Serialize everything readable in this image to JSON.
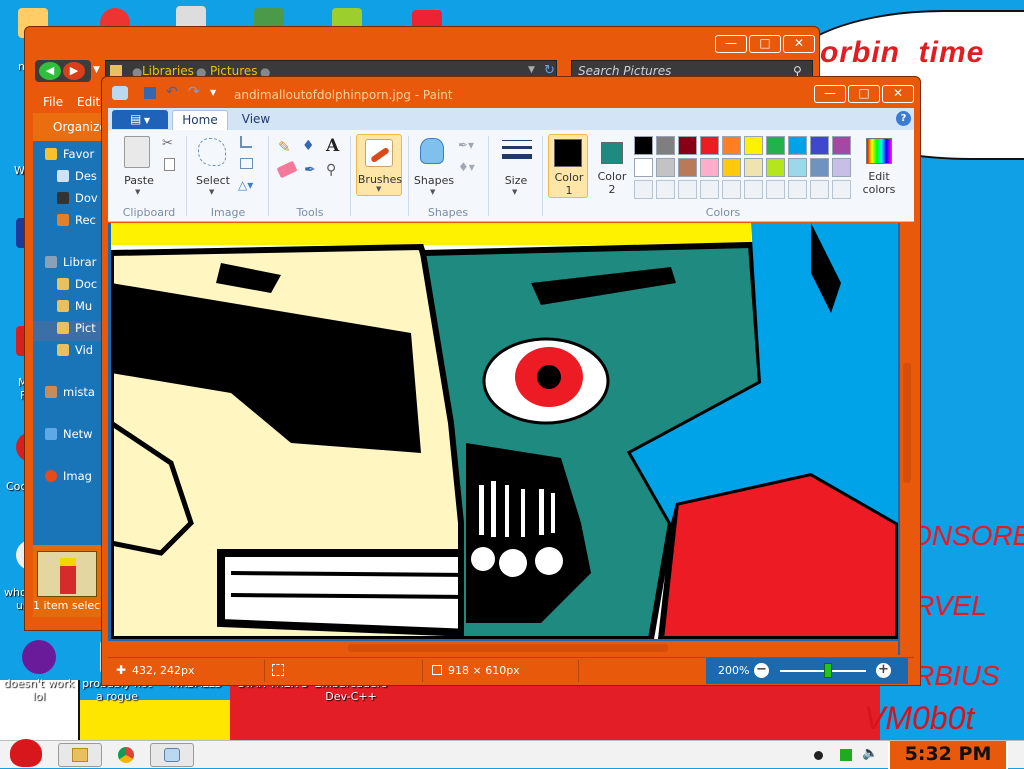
{
  "wallpaper": {
    "title": "orbin  time",
    "words": [
      "ONSORE",
      "RVEL",
      "RBIUS",
      "VM0b0t"
    ]
  },
  "desktop_icons": [
    {
      "label": "doesn't work lol"
    },
    {
      "label": "probably not a rogue"
    },
    {
      "label": "INKBALLS"
    },
    {
      "label": "STAR TREK 3"
    },
    {
      "label": "Embarcadero Dev-C++"
    }
  ],
  "desktop_edge_labels": [
    "m",
    "W",
    "M",
    "F",
    "Coc",
    "who",
    "us"
  ],
  "explorer": {
    "breadcrumb": [
      "Libraries",
      "Pictures"
    ],
    "search_placeholder": "Search Pictures",
    "menu": [
      "File",
      "Edit"
    ],
    "organize_label": "Organize",
    "nav": [
      {
        "label": "Favor",
        "icon": "star-icon"
      },
      {
        "label": "Des",
        "icon": "folder-icon"
      },
      {
        "label": "Dov",
        "icon": "folder-icon"
      },
      {
        "label": "Rec",
        "icon": "folder-icon"
      },
      {
        "label": "Librar",
        "icon": "library-icon"
      },
      {
        "label": "Doc",
        "icon": "folder-icon"
      },
      {
        "label": "Mu",
        "icon": "music-icon"
      },
      {
        "label": "Pict",
        "icon": "picture-icon"
      },
      {
        "label": "Vid",
        "icon": "video-icon"
      },
      {
        "label": "mista",
        "icon": "user-icon"
      },
      {
        "label": "Netw",
        "icon": "network-icon"
      },
      {
        "label": "Imag",
        "icon": "image-icon"
      }
    ],
    "status": "1 item select"
  },
  "paint": {
    "title": "andimalloutofdolphinporn.jpg - Paint",
    "tabs": {
      "file": "",
      "home": "Home",
      "view": "View"
    },
    "ribbon": {
      "paste": "Paste",
      "select": "Select",
      "brushes": "Brushes",
      "shapes": "Shapes",
      "size": "Size",
      "color1": "Color\n1",
      "color2": "Color\n2",
      "edit_colors": "Edit\ncolors",
      "groups": [
        "Clipboard",
        "Image",
        "Tools",
        "Shapes",
        "Colors"
      ]
    },
    "color1": "#000000",
    "color2": "#1f8a80",
    "palette_row1": [
      "#000000",
      "#7f7f7f",
      "#880015",
      "#ed1c24",
      "#ff7f27",
      "#fff200",
      "#22b14c",
      "#00a2e8",
      "#3f48cc",
      "#a349a4"
    ],
    "palette_row2": [
      "#ffffff",
      "#c3c3c3",
      "#b97a57",
      "#ffaec9",
      "#ffc90e",
      "#efe4b0",
      "#b5e61d",
      "#99d9ea",
      "#7092be",
      "#c8bfe7"
    ],
    "status": {
      "cursor": "432, 242px",
      "size": "918 × 610px",
      "zoom": "200%"
    }
  },
  "taskbar": {
    "clock": "5:32 PM"
  }
}
